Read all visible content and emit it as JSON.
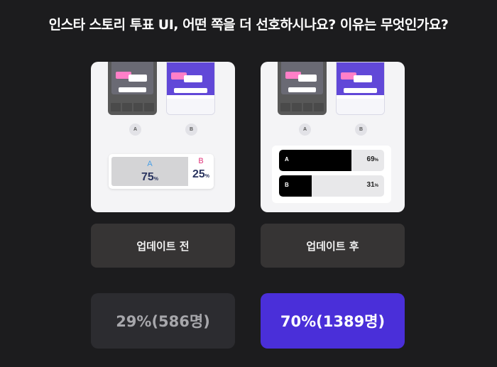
{
  "question": "인스타 스토리 투표 UI, 어떤 쪽을 더 선호하시나요? 이유는 무엇인가요?",
  "colors": {
    "background": "#1c1c1e",
    "selected": "#4a2fd9",
    "unselected": "#2c2c30"
  },
  "options": [
    {
      "id": "before",
      "preview": {
        "option_a": "A",
        "option_b": "B",
        "vote_a_letter": "A",
        "vote_a_value": "75",
        "vote_b_letter": "B",
        "vote_b_value": "25",
        "percent_sign": "%"
      },
      "label": "업데이트 전",
      "result": "29%(586명)",
      "selected": false
    },
    {
      "id": "after",
      "preview": {
        "option_a": "A",
        "option_b": "B",
        "vote_a_letter": "A",
        "vote_a_value": "69",
        "vote_a_fraction": 0.69,
        "vote_b_letter": "B",
        "vote_b_value": "31",
        "vote_b_fraction": 0.31,
        "percent_sign": "%"
      },
      "label": "업데이트 후",
      "result": "70%(1389명)",
      "selected": true
    }
  ]
}
